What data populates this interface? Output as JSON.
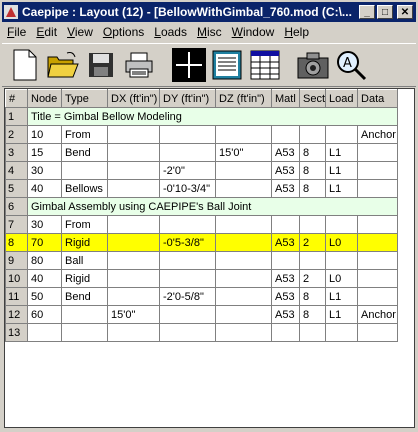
{
  "window": {
    "title": "Caepipe : Layout  (12)  - [BellowWithGimbal_760.mod (C:\\...",
    "minimize_glyph": "_",
    "maximize_glyph": "□",
    "close_glyph": "✕"
  },
  "menu": [
    "File",
    "Edit",
    "View",
    "Options",
    "Loads",
    "Misc",
    "Window",
    "Help"
  ],
  "toolbar": {
    "icons": [
      "new-file-icon",
      "open-folder-icon",
      "save-disk-icon",
      "print-icon",
      "grid-cross-icon",
      "text-list-icon",
      "table-view-icon",
      "camera-icon",
      "magnifier-icon"
    ]
  },
  "table": {
    "headers": [
      "#",
      "Node",
      "Type",
      "DX (ft'in\")",
      "DY (ft'in\")",
      "DZ (ft'in\")",
      "Matl",
      "Sect",
      "Load",
      "Data"
    ],
    "rows": [
      {
        "num": "1",
        "span": "Title = Gimbal Bellow Modeling"
      },
      {
        "num": "2",
        "cells": [
          "10",
          "From",
          "",
          "",
          "",
          "",
          "",
          "",
          "Anchor"
        ]
      },
      {
        "num": "3",
        "cells": [
          "15",
          "Bend",
          "",
          "",
          "15'0\"",
          "A53",
          "8",
          "L1",
          ""
        ]
      },
      {
        "num": "4",
        "cells": [
          "30",
          "",
          "",
          "-2'0\"",
          "",
          "A53",
          "8",
          "L1",
          ""
        ]
      },
      {
        "num": "5",
        "cells": [
          "40",
          "Bellows",
          "",
          "-0'10-3/4\"",
          "",
          "A53",
          "8",
          "L1",
          ""
        ]
      },
      {
        "num": "6",
        "span": "Gimbal Assembly using CAEPIPE's Ball Joint"
      },
      {
        "num": "7",
        "cells": [
          "30",
          "From",
          "",
          "",
          "",
          "",
          "",
          "",
          ""
        ]
      },
      {
        "num": "8",
        "cells": [
          "70",
          "Rigid",
          "",
          "-0'5-3/8\"",
          "",
          "A53",
          "2",
          "L0",
          ""
        ],
        "highlight": true
      },
      {
        "num": "9",
        "cells": [
          "80",
          "Ball",
          "",
          "",
          "",
          "",
          "",
          "",
          ""
        ]
      },
      {
        "num": "10",
        "cells": [
          "40",
          "Rigid",
          "",
          "",
          "",
          "A53",
          "2",
          "L0",
          ""
        ]
      },
      {
        "num": "11",
        "cells": [
          "50",
          "Bend",
          "",
          "-2'0-5/8\"",
          "",
          "A53",
          "8",
          "L1",
          ""
        ]
      },
      {
        "num": "12",
        "cells": [
          "60",
          "",
          "15'0\"",
          "",
          "",
          "A53",
          "8",
          "L1",
          "Anchor"
        ]
      },
      {
        "num": "13",
        "cells": [
          "",
          "",
          "",
          "",
          "",
          "",
          "",
          "",
          ""
        ]
      }
    ]
  },
  "colors": {
    "titlebar": "#0a246a",
    "title_row_bg": "#e8ffe8",
    "highlight": "#ffff00"
  }
}
